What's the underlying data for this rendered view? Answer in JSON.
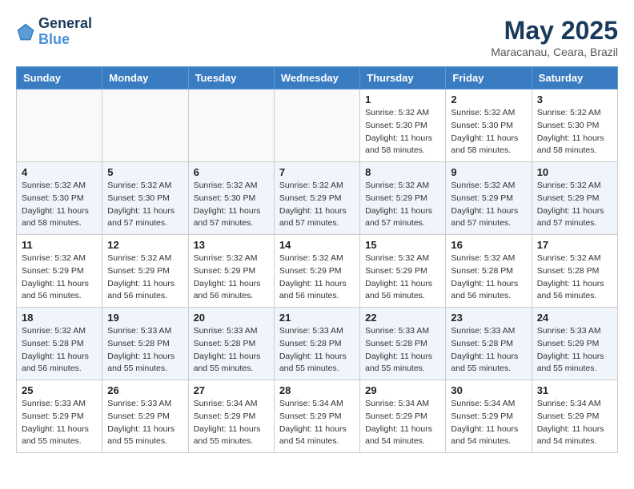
{
  "header": {
    "logo_line1": "General",
    "logo_line2": "Blue",
    "month_title": "May 2025",
    "location": "Maracanau, Ceara, Brazil"
  },
  "weekdays": [
    "Sunday",
    "Monday",
    "Tuesday",
    "Wednesday",
    "Thursday",
    "Friday",
    "Saturday"
  ],
  "weeks": [
    [
      {
        "day": "",
        "info": ""
      },
      {
        "day": "",
        "info": ""
      },
      {
        "day": "",
        "info": ""
      },
      {
        "day": "",
        "info": ""
      },
      {
        "day": "1",
        "info": "Sunrise: 5:32 AM\nSunset: 5:30 PM\nDaylight: 11 hours\nand 58 minutes."
      },
      {
        "day": "2",
        "info": "Sunrise: 5:32 AM\nSunset: 5:30 PM\nDaylight: 11 hours\nand 58 minutes."
      },
      {
        "day": "3",
        "info": "Sunrise: 5:32 AM\nSunset: 5:30 PM\nDaylight: 11 hours\nand 58 minutes."
      }
    ],
    [
      {
        "day": "4",
        "info": "Sunrise: 5:32 AM\nSunset: 5:30 PM\nDaylight: 11 hours\nand 58 minutes."
      },
      {
        "day": "5",
        "info": "Sunrise: 5:32 AM\nSunset: 5:30 PM\nDaylight: 11 hours\nand 57 minutes."
      },
      {
        "day": "6",
        "info": "Sunrise: 5:32 AM\nSunset: 5:30 PM\nDaylight: 11 hours\nand 57 minutes."
      },
      {
        "day": "7",
        "info": "Sunrise: 5:32 AM\nSunset: 5:29 PM\nDaylight: 11 hours\nand 57 minutes."
      },
      {
        "day": "8",
        "info": "Sunrise: 5:32 AM\nSunset: 5:29 PM\nDaylight: 11 hours\nand 57 minutes."
      },
      {
        "day": "9",
        "info": "Sunrise: 5:32 AM\nSunset: 5:29 PM\nDaylight: 11 hours\nand 57 minutes."
      },
      {
        "day": "10",
        "info": "Sunrise: 5:32 AM\nSunset: 5:29 PM\nDaylight: 11 hours\nand 57 minutes."
      }
    ],
    [
      {
        "day": "11",
        "info": "Sunrise: 5:32 AM\nSunset: 5:29 PM\nDaylight: 11 hours\nand 56 minutes."
      },
      {
        "day": "12",
        "info": "Sunrise: 5:32 AM\nSunset: 5:29 PM\nDaylight: 11 hours\nand 56 minutes."
      },
      {
        "day": "13",
        "info": "Sunrise: 5:32 AM\nSunset: 5:29 PM\nDaylight: 11 hours\nand 56 minutes."
      },
      {
        "day": "14",
        "info": "Sunrise: 5:32 AM\nSunset: 5:29 PM\nDaylight: 11 hours\nand 56 minutes."
      },
      {
        "day": "15",
        "info": "Sunrise: 5:32 AM\nSunset: 5:29 PM\nDaylight: 11 hours\nand 56 minutes."
      },
      {
        "day": "16",
        "info": "Sunrise: 5:32 AM\nSunset: 5:28 PM\nDaylight: 11 hours\nand 56 minutes."
      },
      {
        "day": "17",
        "info": "Sunrise: 5:32 AM\nSunset: 5:28 PM\nDaylight: 11 hours\nand 56 minutes."
      }
    ],
    [
      {
        "day": "18",
        "info": "Sunrise: 5:32 AM\nSunset: 5:28 PM\nDaylight: 11 hours\nand 56 minutes."
      },
      {
        "day": "19",
        "info": "Sunrise: 5:33 AM\nSunset: 5:28 PM\nDaylight: 11 hours\nand 55 minutes."
      },
      {
        "day": "20",
        "info": "Sunrise: 5:33 AM\nSunset: 5:28 PM\nDaylight: 11 hours\nand 55 minutes."
      },
      {
        "day": "21",
        "info": "Sunrise: 5:33 AM\nSunset: 5:28 PM\nDaylight: 11 hours\nand 55 minutes."
      },
      {
        "day": "22",
        "info": "Sunrise: 5:33 AM\nSunset: 5:28 PM\nDaylight: 11 hours\nand 55 minutes."
      },
      {
        "day": "23",
        "info": "Sunrise: 5:33 AM\nSunset: 5:28 PM\nDaylight: 11 hours\nand 55 minutes."
      },
      {
        "day": "24",
        "info": "Sunrise: 5:33 AM\nSunset: 5:29 PM\nDaylight: 11 hours\nand 55 minutes."
      }
    ],
    [
      {
        "day": "25",
        "info": "Sunrise: 5:33 AM\nSunset: 5:29 PM\nDaylight: 11 hours\nand 55 minutes."
      },
      {
        "day": "26",
        "info": "Sunrise: 5:33 AM\nSunset: 5:29 PM\nDaylight: 11 hours\nand 55 minutes."
      },
      {
        "day": "27",
        "info": "Sunrise: 5:34 AM\nSunset: 5:29 PM\nDaylight: 11 hours\nand 55 minutes."
      },
      {
        "day": "28",
        "info": "Sunrise: 5:34 AM\nSunset: 5:29 PM\nDaylight: 11 hours\nand 54 minutes."
      },
      {
        "day": "29",
        "info": "Sunrise: 5:34 AM\nSunset: 5:29 PM\nDaylight: 11 hours\nand 54 minutes."
      },
      {
        "day": "30",
        "info": "Sunrise: 5:34 AM\nSunset: 5:29 PM\nDaylight: 11 hours\nand 54 minutes."
      },
      {
        "day": "31",
        "info": "Sunrise: 5:34 AM\nSunset: 5:29 PM\nDaylight: 11 hours\nand 54 minutes."
      }
    ]
  ]
}
